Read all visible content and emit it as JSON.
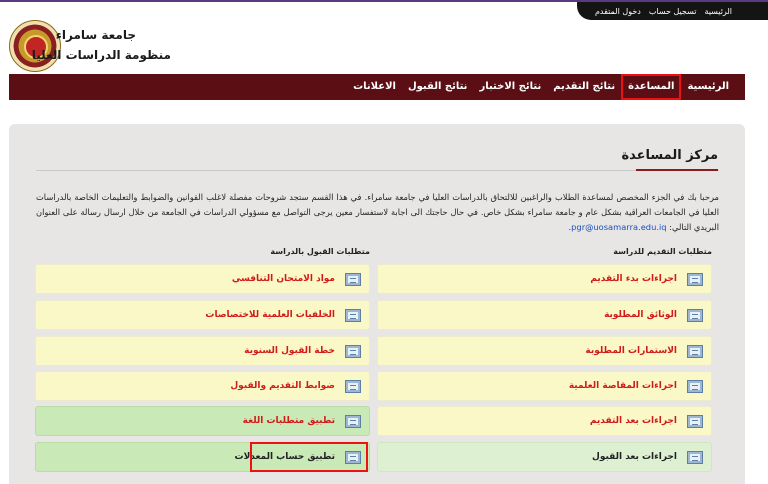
{
  "top_bar": {
    "links": [
      "دخول المتقدم",
      "تسجيل حساب",
      "الرئيسية"
    ]
  },
  "header": {
    "university": "جامعة سامراء",
    "system": "منظومة الدراسات العليا"
  },
  "nav": {
    "items": [
      "الرئيسية",
      "المساعدة",
      "نتائج التقديم",
      "نتائج الاختبار",
      "نتائج القبول",
      "الاعلانات"
    ],
    "active_index": 1
  },
  "help": {
    "title": "مركز المساعدة",
    "intro_1": "مرحبا بك في الجزء المخصص لمساعدة الطلاب والراغبين للالتحاق بالدراسات العليا في جامعة سامراء. في هذا القسم ستجد شروحات مفصلة لاغلب القوانين والضوابط والتعليمات الخاصة بالدراسات العليا في الجامعات العراقية بشكل عام و جامعة سامراء بشكل خاص. في حال حاجتك الى اجابة لاستفسار معين يرجى التواصل مع مسؤولي الدراسات في الجامعة من خلال ارسال رسالة على العنوان البريدي التالي: ",
    "email": "pgr@uosamarra.edu.iq",
    "intro_end": ".",
    "col_right_title": "متطلبات التقديم للدراسة",
    "col_left_title": "متطلبات القبول بالدراسة",
    "right_items": [
      "اجراءات بدء التقديم",
      "الوثائق المطلوبة",
      "الاستمارات المطلوبة",
      "اجراءات المقاصة العلمية",
      "اجراءات بعد التقديم",
      "اجراءات بعد القبول"
    ],
    "left_items": [
      "مواد الامتحان التنافسي",
      "الخلفيات العلمية للاختصاصات",
      "خطة القبول السنوية",
      "ضوابط التقديم والقبول",
      "تطبيق متطلبات اللغة",
      "تطبيق حساب المعدلات"
    ]
  },
  "colors": {
    "nav_bg": "#5b0f14",
    "item_yellow": "#fbf8c8",
    "item_green": "#c9e9b6",
    "label_red": "#d11a1a",
    "highlight": "#ee1111"
  },
  "icons": [
    "university-seal",
    "document-icon"
  ]
}
